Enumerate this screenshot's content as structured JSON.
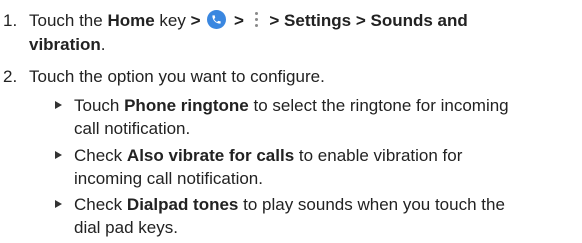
{
  "steps": [
    {
      "number": "1.",
      "parts": {
        "touch": "Touch the ",
        "home": "Home",
        "key": " key ",
        "gt1": ">",
        "gt2": ">",
        "tail": " > Settings > Sounds and",
        "tail2": "vibration",
        "period": "."
      },
      "icons": [
        "phone-icon",
        "more-vert-icon"
      ],
      "colors": {
        "phone_icon_bg": "#3a87e0",
        "dots": "#8a8a8a"
      }
    },
    {
      "number": "2.",
      "text": "Touch the option you want to configure."
    }
  ],
  "bullets": [
    {
      "prefix": "Touch ",
      "bold": "Phone ringtone",
      "rest_line1": " to select the ringtone for incoming",
      "line2": "call notification."
    },
    {
      "prefix": "Check ",
      "bold": "Also vibrate for calls",
      "rest_line1": " to enable vibration for",
      "line2": "incoming call notification."
    },
    {
      "prefix": "Check ",
      "bold": "Dialpad tones",
      "rest_line1": " to play sounds when you touch the",
      "line2": "dial pad keys."
    }
  ]
}
